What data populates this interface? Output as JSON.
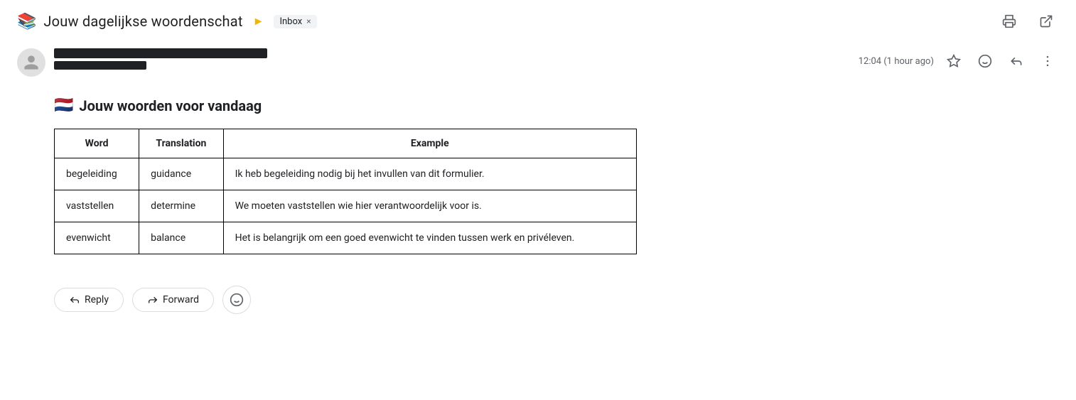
{
  "header": {
    "subject_icon": "📚",
    "title": "Jouw dagelijkse woordenschat",
    "arrow": "▶",
    "inbox_label": "Inbox",
    "inbox_close": "×",
    "print_icon": "print",
    "popout_icon": "open_in_new"
  },
  "sender": {
    "timestamp": "12:04 (1 hour ago)",
    "star_icon": "star",
    "emoji_icon": "emoji",
    "reply_icon": "reply",
    "more_icon": "more_vert"
  },
  "email": {
    "heading_flag": "🇳🇱",
    "heading_text": "Jouw woorden voor vandaag",
    "table": {
      "columns": [
        "Word",
        "Translation",
        "Example"
      ],
      "rows": [
        {
          "word": "begeleiding",
          "translation": "guidance",
          "example": "Ik heb begeleiding nodig bij het invullen van dit formulier."
        },
        {
          "word": "vaststellen",
          "translation": "determine",
          "example": "We moeten vaststellen wie hier verantwoordelijk voor is."
        },
        {
          "word": "evenwicht",
          "translation": "balance",
          "example": "Het is belangrijk om een goed evenwicht te vinden tussen werk en privéleven."
        }
      ]
    }
  },
  "actions": {
    "reply_label": "Reply",
    "forward_label": "Forward",
    "emoji_label": "😊"
  }
}
